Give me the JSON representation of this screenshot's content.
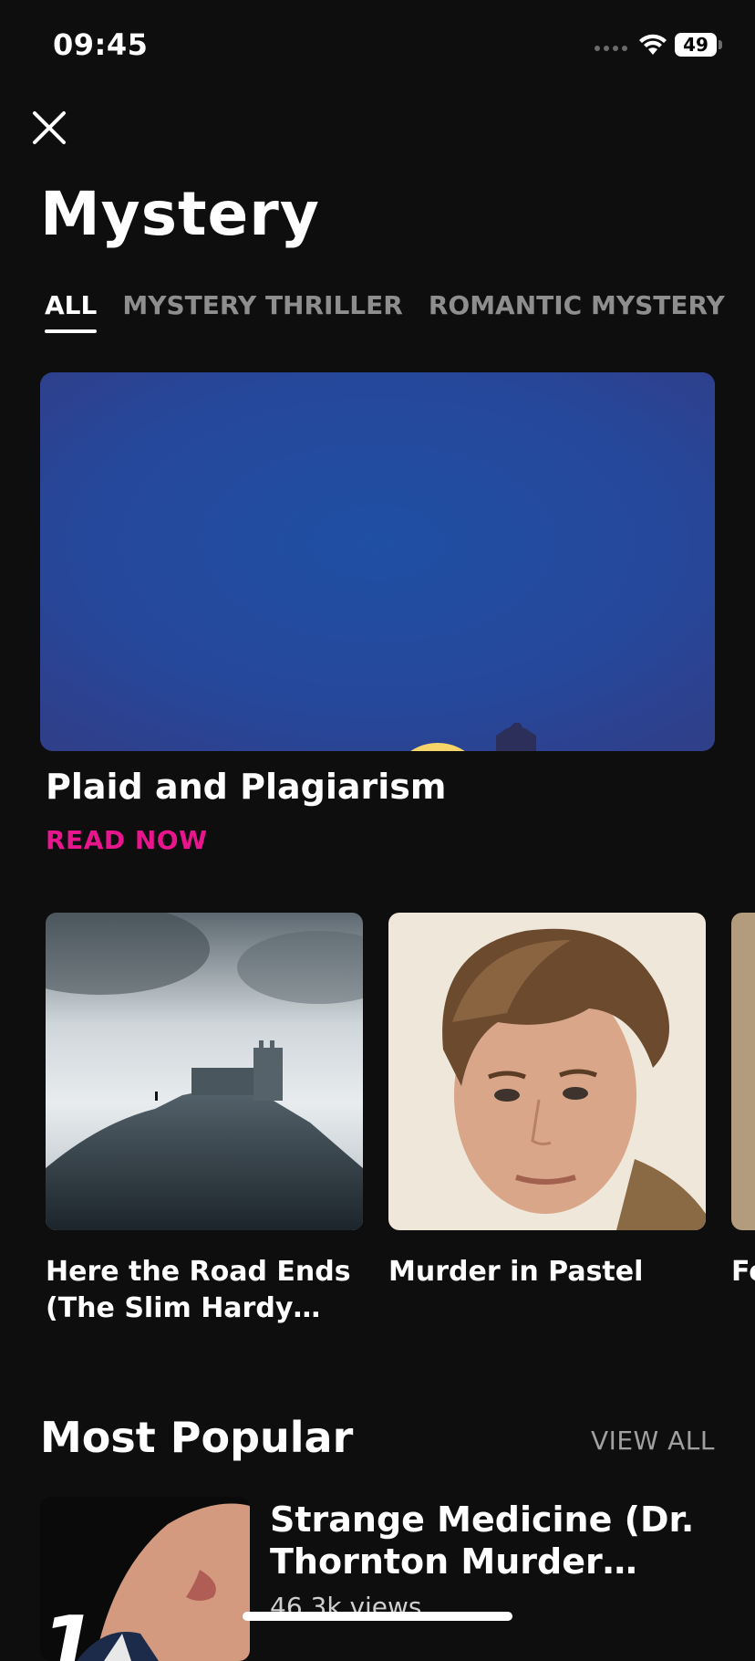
{
  "status_bar": {
    "time": "09:45",
    "battery": "49"
  },
  "page": {
    "title": "Mystery"
  },
  "tabs": [
    {
      "label": "ALL",
      "active": true
    },
    {
      "label": "MYSTERY THRILLER",
      "active": false
    },
    {
      "label": "ROMANTIC MYSTERY",
      "active": false
    }
  ],
  "featured": {
    "title": "Plaid and Plagiarism",
    "cta": "READ NOW",
    "accent_color": "#e8158c"
  },
  "books": [
    {
      "title": "Here the Road Ends (The Slim Hardy Myst…"
    },
    {
      "title": "Murder in Pastel"
    },
    {
      "title": "Fo"
    }
  ],
  "most_popular": {
    "title": "Most Popular",
    "view_all": "VIEW ALL",
    "items": [
      {
        "title": "Strange Medicine (Dr. Thornton Murder Mysteri…",
        "views": "46.3k views",
        "rank": "1"
      }
    ]
  },
  "icons": {
    "close": "close-icon",
    "wifi": "wifi-icon",
    "signal": "signal-icon",
    "battery": "battery-icon"
  }
}
